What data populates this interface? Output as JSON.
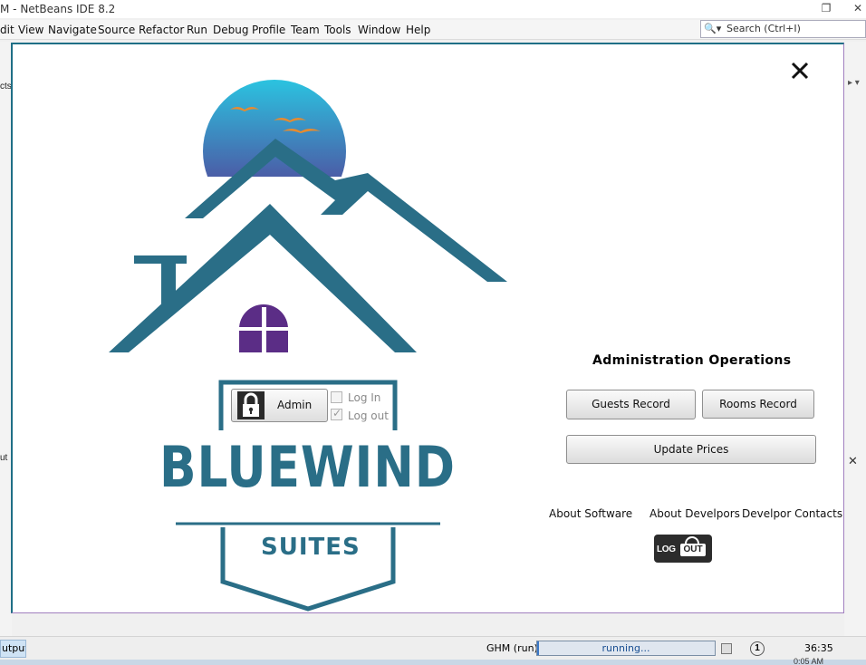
{
  "ide": {
    "title": "M - NetBeans IDE 8.2",
    "menu": [
      "dit",
      "View",
      "Navigate",
      "Source",
      "Refactor",
      "Run",
      "Debug",
      "Profile",
      "Team",
      "Tools",
      "Window",
      "Help"
    ],
    "search_placeholder": "Search (Ctrl+I)",
    "left_fragments": [
      "cts",
      "ut"
    ],
    "status": {
      "output_tab": "utput",
      "process": "GHM (run)",
      "progress_text": "running...",
      "position": "36:35",
      "tray_time": "0:05 AM"
    }
  },
  "app": {
    "brand_main": "BLUEWIND",
    "brand_sub": "SUITES",
    "admin_button": "Admin",
    "login_label": "Log In",
    "logout_label": "Log out",
    "login_checked": false,
    "logout_checked": true,
    "ops_title": "Administration Operations",
    "buttons": {
      "guests": "Guests Record",
      "rooms": "Rooms Record",
      "prices": "Update Prices"
    },
    "links": {
      "about_software": "About Software",
      "about_developers": "About Develpors",
      "developer_contacts": "Develpor Contacts"
    },
    "logout_button": {
      "part1": "LOG",
      "part2": "OUT"
    }
  },
  "colors": {
    "teal": "#2a6e87",
    "sky_top": "#2bc3e0",
    "sky_bottom": "#5a2d8c",
    "bird": "#e88b2e",
    "window": "#5b2d86"
  }
}
